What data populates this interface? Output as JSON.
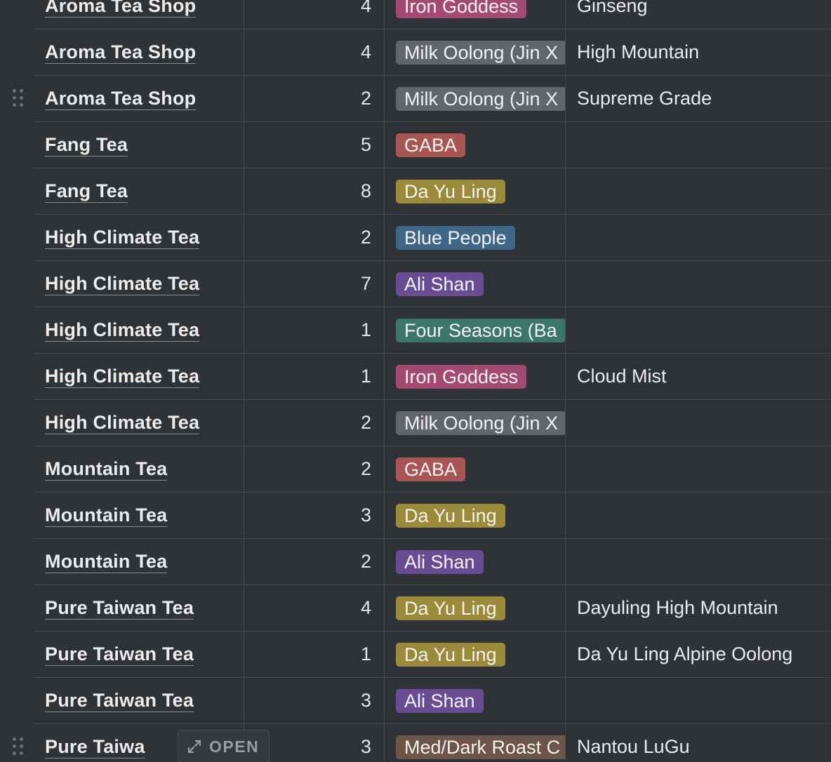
{
  "colors": {
    "background": "#2f3337",
    "gridline": "#474b50",
    "tag_iron_goddess": "#a34a72",
    "tag_milk_oolong": "#626569",
    "tag_gaba": "#a85654",
    "tag_da_yu_ling": "#9a8a3a",
    "tag_blue_people": "#3e6787",
    "tag_ali_shan": "#6a4c94",
    "tag_four_seasons": "#3b7768",
    "tag_med_dark_roast": "#6e5549"
  },
  "icons": {
    "drag_handle": "drag-handle-icon",
    "open": "expand-diagonal-icon"
  },
  "open_button_label": "OPEN",
  "rows": [
    {
      "shop": "Aroma Tea Shop",
      "quantity": "4",
      "tea_type": "Iron Goddess",
      "tag_color": "#a34a72",
      "name": "Ginseng"
    },
    {
      "shop": "Aroma Tea Shop",
      "quantity": "4",
      "tea_type": "Milk Oolong (Jin X",
      "tag_color": "#626569",
      "name": "High Mountain"
    },
    {
      "shop": "Aroma Tea Shop",
      "quantity": "2",
      "tea_type": "Milk Oolong (Jin X",
      "tag_color": "#626569",
      "name": "Supreme Grade"
    },
    {
      "shop": "Fang Tea",
      "quantity": "5",
      "tea_type": "GABA",
      "tag_color": "#a85654",
      "name": ""
    },
    {
      "shop": "Fang Tea",
      "quantity": "8",
      "tea_type": "Da Yu Ling",
      "tag_color": "#9a8a3a",
      "name": ""
    },
    {
      "shop": "High Climate Tea",
      "quantity": "2",
      "tea_type": "Blue People",
      "tag_color": "#3e6787",
      "name": ""
    },
    {
      "shop": "High Climate Tea",
      "quantity": "7",
      "tea_type": "Ali Shan",
      "tag_color": "#6a4c94",
      "name": ""
    },
    {
      "shop": "High Climate Tea",
      "quantity": "1",
      "tea_type": "Four Seasons (Ba",
      "tag_color": "#3b7768",
      "name": ""
    },
    {
      "shop": "High Climate Tea",
      "quantity": "1",
      "tea_type": "Iron Goddess",
      "tag_color": "#a34a72",
      "name": "Cloud Mist"
    },
    {
      "shop": "High Climate Tea",
      "quantity": "2",
      "tea_type": "Milk Oolong (Jin X",
      "tag_color": "#626569",
      "name": ""
    },
    {
      "shop": "Mountain Tea",
      "quantity": "2",
      "tea_type": "GABA",
      "tag_color": "#a85654",
      "name": ""
    },
    {
      "shop": "Mountain Tea",
      "quantity": "3",
      "tea_type": "Da Yu Ling",
      "tag_color": "#9a8a3a",
      "name": ""
    },
    {
      "shop": "Mountain Tea",
      "quantity": "2",
      "tea_type": "Ali Shan",
      "tag_color": "#6a4c94",
      "name": ""
    },
    {
      "shop": "Pure Taiwan Tea",
      "quantity": "4",
      "tea_type": "Da Yu Ling",
      "tag_color": "#9a8a3a",
      "name": "Dayuling High Mountain"
    },
    {
      "shop": "Pure Taiwan Tea",
      "quantity": "1",
      "tea_type": "Da Yu Ling",
      "tag_color": "#9a8a3a",
      "name": "Da Yu Ling Alpine Oolong"
    },
    {
      "shop": "Pure Taiwan Tea",
      "quantity": "3",
      "tea_type": "Ali Shan",
      "tag_color": "#6a4c94",
      "name": ""
    },
    {
      "shop": "Pure Taiwa",
      "quantity": "3",
      "tea_type": "Med/Dark Roast C",
      "tag_color": "#6e5549",
      "name": "Nantou LuGu"
    }
  ]
}
